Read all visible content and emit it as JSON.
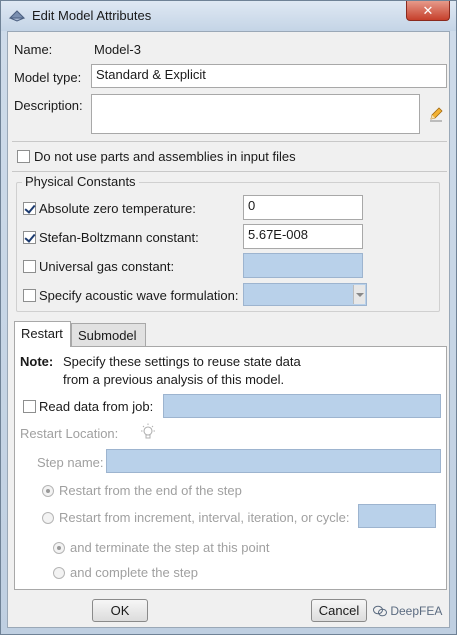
{
  "window": {
    "title": "Edit Model Attributes",
    "close_label": "✕"
  },
  "form": {
    "name_label": "Name:",
    "name_value": "Model-3",
    "model_type_label": "Model type:",
    "model_type_value": "Standard & Explicit",
    "description_label": "Description:",
    "description_value": "",
    "no_parts_label": "Do not use parts and assemblies in input files",
    "no_parts_checked": false
  },
  "physical_constants": {
    "title": "Physical Constants",
    "absolute_zero_label": "Absolute zero temperature:",
    "absolute_zero_checked": true,
    "absolute_zero_value": "0",
    "stefan_label": "Stefan-Boltzmann constant:",
    "stefan_checked": true,
    "stefan_value": "5.67E-008",
    "gas_label": "Universal gas constant:",
    "gas_checked": false,
    "gas_value": "",
    "acoustic_label": "Specify acoustic wave formulation:",
    "acoustic_checked": false,
    "acoustic_value": ""
  },
  "tabs": [
    {
      "label": "Restart",
      "active": true
    },
    {
      "label": "Submodel",
      "active": false
    }
  ],
  "restart": {
    "note_bold": "Note:",
    "note_line1": "Specify these settings to reuse state data",
    "note_line2": "from a previous analysis of this model.",
    "read_data_label": "Read data from job:",
    "read_data_checked": false,
    "read_data_value": "",
    "location_label": "Restart Location:",
    "step_name_label": "Step name:",
    "step_name_value": "",
    "radio_end_label": "Restart from the end of the step",
    "radio_end_selected": true,
    "radio_increment_label": "Restart from increment, interval, iteration, or cycle:",
    "radio_increment_selected": false,
    "increment_value": "",
    "terminate_label": "and terminate the step at this point",
    "terminate_selected": true,
    "complete_label": "and complete the step",
    "complete_selected": false
  },
  "buttons": {
    "ok": "OK",
    "cancel": "Cancel"
  },
  "watermark": "DeepFEA",
  "colors": {
    "disabled_field": "#b9d1ea",
    "title_bar": "#c4d4e6",
    "close_button": "#c6402c"
  }
}
